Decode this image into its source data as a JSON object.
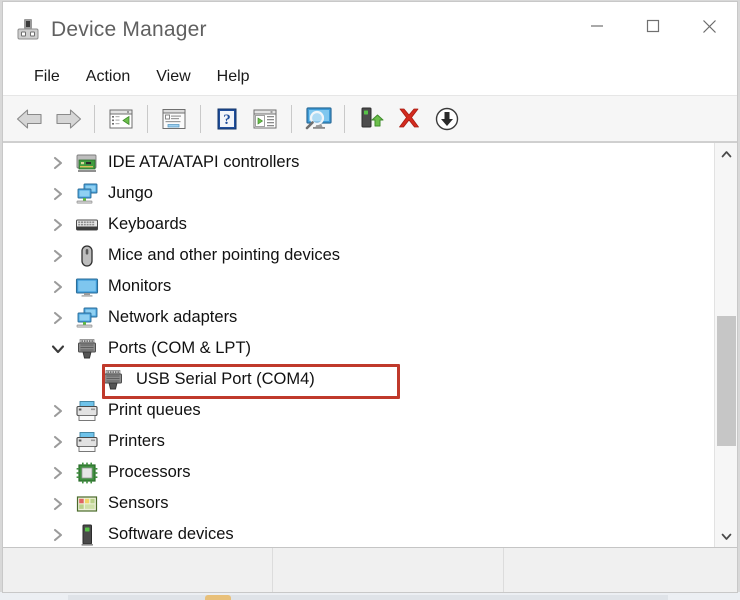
{
  "window": {
    "title": "Device Manager",
    "title_icon": "device-manager-icon",
    "controls": [
      {
        "name": "minimize-button",
        "glyph": "minimize-icon"
      },
      {
        "name": "maximize-button",
        "glyph": "maximize-icon"
      },
      {
        "name": "close-button",
        "glyph": "close-icon"
      }
    ]
  },
  "menubar": {
    "items": [
      {
        "label": "File",
        "name": "menu-file"
      },
      {
        "label": "Action",
        "name": "menu-action"
      },
      {
        "label": "View",
        "name": "menu-view"
      },
      {
        "label": "Help",
        "name": "menu-help"
      }
    ]
  },
  "toolbar": {
    "buttons": [
      {
        "name": "back-button",
        "icon": "back-arrow-icon",
        "tooltip": "Back"
      },
      {
        "name": "forward-button",
        "icon": "forward-arrow-icon",
        "tooltip": "Forward"
      },
      {
        "name": "show-hide-console-tree-button",
        "icon": "console-tree-icon",
        "tooltip": "Show/Hide Console Tree"
      },
      {
        "name": "properties-button",
        "icon": "properties-icon",
        "tooltip": "Properties"
      },
      {
        "name": "help-button",
        "icon": "help-question-icon",
        "tooltip": "Help"
      },
      {
        "name": "show-hide-action-pane-button",
        "icon": "action-pane-icon",
        "tooltip": "Show/Hide Action Pane"
      },
      {
        "name": "scan-for-hardware-changes-button",
        "icon": "scan-hardware-icon",
        "tooltip": "Scan for hardware changes"
      },
      {
        "name": "enable-device-button",
        "icon": "enable-device-icon",
        "tooltip": "Enable device"
      },
      {
        "name": "uninstall-device-button",
        "icon": "red-x-delete-icon",
        "tooltip": "Uninstall device"
      },
      {
        "name": "update-driver-button",
        "icon": "download-update-icon",
        "tooltip": "Update driver"
      }
    ]
  },
  "tree": {
    "rows": [
      {
        "label": "IDE ATA/ATAPI controllers",
        "icon": "ide-controller-icon",
        "expander": "collapsed",
        "level": 1,
        "name": "tree-item-ide-ata-atapi-controllers"
      },
      {
        "label": "Jungo",
        "icon": "network-stack-icon",
        "expander": "collapsed",
        "level": 1,
        "name": "tree-item-jungo"
      },
      {
        "label": "Keyboards",
        "icon": "keyboard-icon",
        "expander": "collapsed",
        "level": 1,
        "name": "tree-item-keyboards"
      },
      {
        "label": "Mice and other pointing devices",
        "icon": "mouse-icon",
        "expander": "collapsed",
        "level": 1,
        "name": "tree-item-mice-and-other-pointing-devices"
      },
      {
        "label": "Monitors",
        "icon": "monitor-icon",
        "expander": "collapsed",
        "level": 1,
        "name": "tree-item-monitors"
      },
      {
        "label": "Network adapters",
        "icon": "network-stack-icon",
        "expander": "collapsed",
        "level": 1,
        "name": "tree-item-network-adapters"
      },
      {
        "label": "Ports (COM & LPT)",
        "icon": "serial-port-icon",
        "expander": "expanded",
        "level": 1,
        "name": "tree-item-ports-com-and-lpt"
      },
      {
        "label": "USB Serial Port (COM4)",
        "icon": "serial-port-icon",
        "expander": "none",
        "level": 2,
        "name": "tree-item-usb-serial-port-com4",
        "highlighted": true
      },
      {
        "label": "Print queues",
        "icon": "printer-icon",
        "expander": "collapsed",
        "level": 1,
        "name": "tree-item-print-queues"
      },
      {
        "label": "Printers",
        "icon": "printer-icon",
        "expander": "collapsed",
        "level": 1,
        "name": "tree-item-printers"
      },
      {
        "label": "Processors",
        "icon": "processor-chip-icon",
        "expander": "collapsed",
        "level": 1,
        "name": "tree-item-processors"
      },
      {
        "label": "Sensors",
        "icon": "sensors-icon",
        "expander": "collapsed",
        "level": 1,
        "name": "tree-item-sensors"
      },
      {
        "label": "Software devices",
        "icon": "software-device-icon",
        "expander": "collapsed",
        "level": 1,
        "name": "tree-item-software-devices"
      }
    ]
  },
  "annotation": {
    "target": "USB Serial Port (COM4)",
    "color": "#c0392b",
    "border_width": 3
  },
  "scrollbar": {
    "up_arrow": "chevron-up-icon",
    "down_arrow": "chevron-down-icon",
    "thumb_color": "#c6c6c6",
    "thumb_top_pct": 42,
    "thumb_height_pct": 36
  },
  "statusbar": {
    "panels": [
      "",
      "",
      ""
    ]
  }
}
